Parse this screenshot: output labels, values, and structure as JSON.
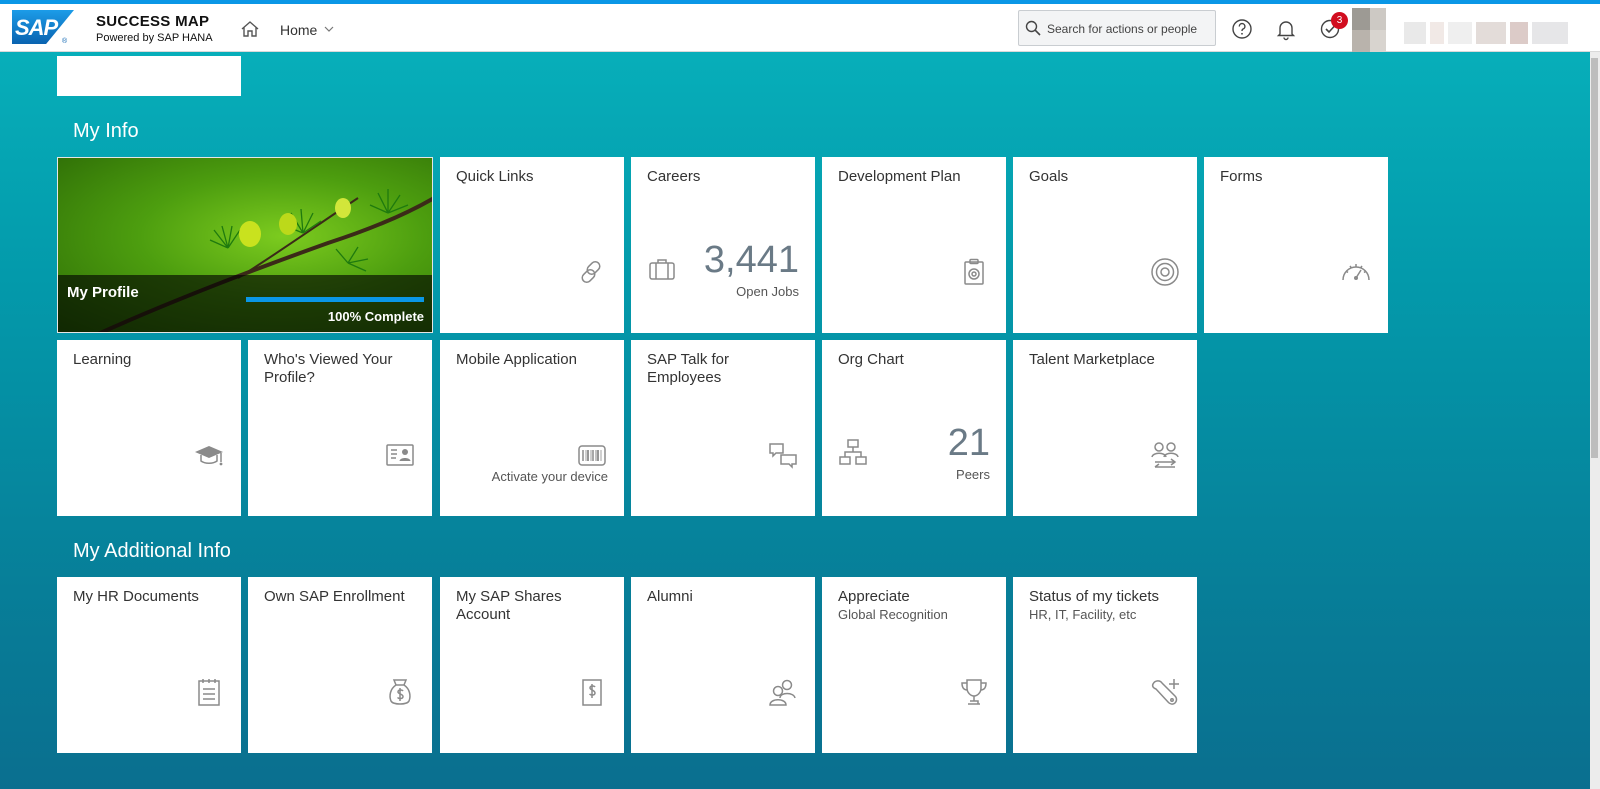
{
  "shell": {
    "logo_text": "SAP",
    "app_title": "SUCCESS MAP",
    "app_subtitle": "Powered by SAP HANA",
    "nav_label": "Home",
    "search_placeholder": "Search for actions or people",
    "notifications_badge": "3",
    "icons": [
      "home-icon",
      "chevron-down-icon",
      "search-icon",
      "help-icon",
      "bell-icon",
      "tasks-check-icon"
    ]
  },
  "my_info": {
    "title": "My Info",
    "profile": {
      "label": "My Profile",
      "completion_percent": 100,
      "completion_text": "100% Complete"
    },
    "tiles": [
      {
        "title": "Quick Links",
        "icon": "link-icon"
      },
      {
        "title": "Careers",
        "icon": "briefcase-icon",
        "kpi": "3,441",
        "kpi_label": "Open Jobs"
      },
      {
        "title": "Development Plan",
        "icon": "clipboard-target-icon"
      },
      {
        "title": "Goals",
        "icon": "target-icon"
      },
      {
        "title": "Forms",
        "icon": "speedometer-icon"
      },
      {
        "title": "Learning",
        "icon": "graduation-cap-icon"
      },
      {
        "title": "Who's Viewed Your Profile?",
        "icon": "id-card-icon"
      },
      {
        "title": "Mobile Application",
        "icon": "barcode-icon",
        "footer": "Activate your device"
      },
      {
        "title": "SAP Talk for Employees",
        "icon": "chat-bubbles-icon"
      },
      {
        "title": "Org Chart",
        "icon": "org-chart-icon",
        "kpi": "21",
        "kpi_label": "Peers"
      },
      {
        "title": "Talent Marketplace",
        "icon": "people-exchange-icon"
      }
    ]
  },
  "additional_info": {
    "title": "My Additional Info",
    "tiles": [
      {
        "title": "My HR Documents",
        "icon": "notepad-icon"
      },
      {
        "title": "Own SAP Enrollment",
        "icon": "money-bag-icon"
      },
      {
        "title": "My SAP Shares Account",
        "icon": "dollar-document-icon"
      },
      {
        "title": "Alumni",
        "icon": "people-icon"
      },
      {
        "title": "Appreciate",
        "subtitle": "Global Recognition",
        "icon": "trophy-icon"
      },
      {
        "title": "Status of my tickets",
        "subtitle": "HR, IT, Facility, etc",
        "icon": "wrench-add-icon"
      }
    ]
  }
}
